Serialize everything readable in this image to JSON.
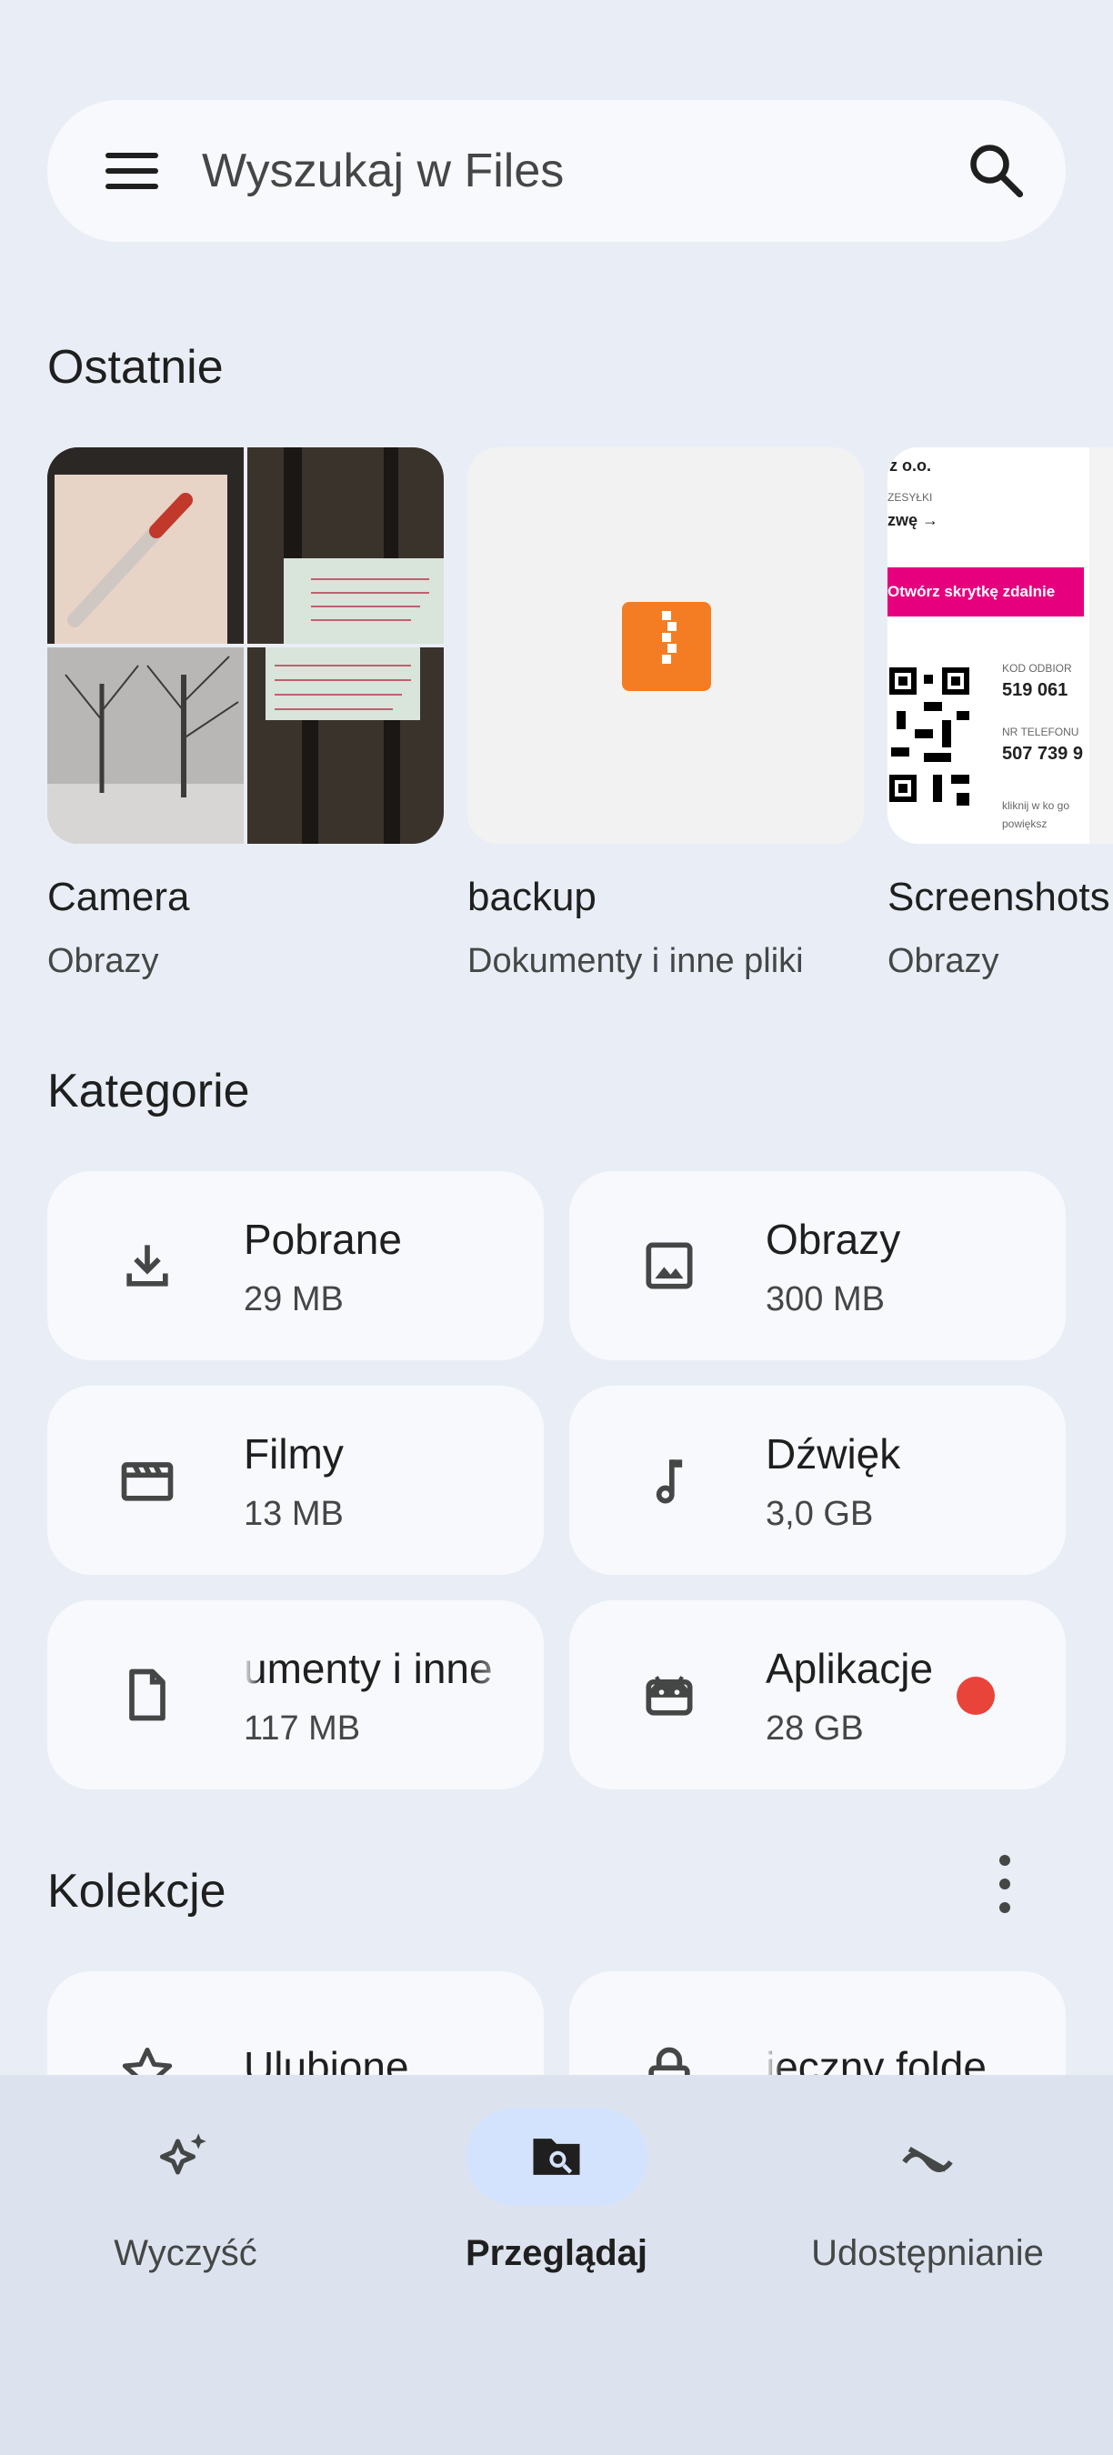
{
  "search": {
    "placeholder": "Wyszukaj w Files"
  },
  "sections": {
    "recent": "Ostatnie",
    "categories": "Kategorie",
    "collections": "Kolekcje"
  },
  "recent": [
    {
      "name": "Camera",
      "type": "Obrazy"
    },
    {
      "name": "backup",
      "type": "Dokumenty i inne pliki"
    },
    {
      "name": "Screenshots",
      "type": "Obrazy"
    }
  ],
  "screenshot_preview": {
    "company": "z o.o.",
    "shipments": "ZESYŁKI",
    "new": "zwę →",
    "banner": "Otwórz skrytkę zdalnie",
    "pickup_code_label": "KOD ODBIOR",
    "pickup_code": "519 061",
    "phone_label": "NR TELEFONU",
    "phone": "507 739 9",
    "hint": "kliknij w ko go powiększ"
  },
  "categories": [
    {
      "label": "Pobrane",
      "size": "29 MB",
      "icon": "download-icon"
    },
    {
      "label": "Obrazy",
      "size": "300 MB",
      "icon": "image-icon"
    },
    {
      "label": "Filmy",
      "size": "13 MB",
      "icon": "movie-icon"
    },
    {
      "label": "Dźwięk",
      "size": "3,0 GB",
      "icon": "music-note-icon"
    },
    {
      "label": "umenty i inne",
      "size": "117 MB",
      "icon": "document-icon"
    },
    {
      "label": "Aplikacje",
      "size": "28 GB",
      "icon": "android-icon"
    }
  ],
  "collections": [
    {
      "label": "Ulubione",
      "icon": "star-icon"
    },
    {
      "label": "ieczny folde",
      "icon": "lock-icon"
    }
  ],
  "nav": [
    {
      "label": "Wyczyść",
      "icon": "sparkle-icon",
      "active": false
    },
    {
      "label": "Przeglądaj",
      "icon": "browse-folder-icon",
      "active": true
    },
    {
      "label": "Udostępnianie",
      "icon": "share-swap-icon",
      "active": false
    }
  ],
  "colors": {
    "background": "#e9eef6",
    "card": "#f8f9fd",
    "accent_pill": "#d3e3fd",
    "zip": "#f47d23",
    "badge": "#e8443a"
  }
}
